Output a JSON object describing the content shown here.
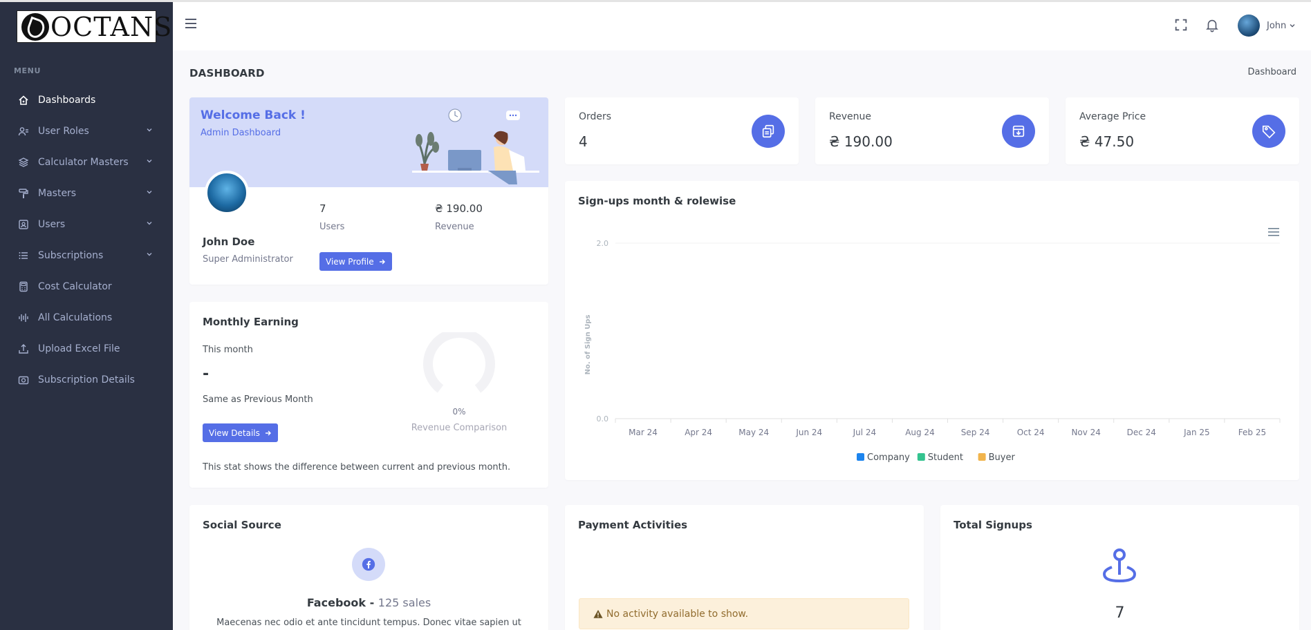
{
  "brand": {
    "logo_text": "OCTANS"
  },
  "sidebar": {
    "menu_title": "MENU",
    "items": [
      {
        "label": "Dashboards",
        "icon": "home-icon",
        "active": true,
        "has_children": false
      },
      {
        "label": "User Roles",
        "icon": "user-roles-icon",
        "active": false,
        "has_children": true
      },
      {
        "label": "Calculator Masters",
        "icon": "layers-icon",
        "active": false,
        "has_children": true
      },
      {
        "label": "Masters",
        "icon": "paint-roller-icon",
        "active": false,
        "has_children": true
      },
      {
        "label": "Users",
        "icon": "user-card-icon",
        "active": false,
        "has_children": true
      },
      {
        "label": "Subscriptions",
        "icon": "list-icon",
        "active": false,
        "has_children": true
      },
      {
        "label": "Cost Calculator",
        "icon": "calculator-icon",
        "active": false,
        "has_children": false
      },
      {
        "label": "All Calculations",
        "icon": "equalizer-icon",
        "active": false,
        "has_children": false
      },
      {
        "label": "Upload Excel File",
        "icon": "upload-icon",
        "active": false,
        "has_children": false
      },
      {
        "label": "Subscription Details",
        "icon": "camera-icon",
        "active": false,
        "has_children": false
      }
    ]
  },
  "topbar": {
    "user_name": "John"
  },
  "page": {
    "title": "DASHBOARD",
    "breadcrumb": "Dashboard"
  },
  "welcome": {
    "heading": "Welcome Back !",
    "subheading": "Admin Dashboard",
    "name": "John Doe",
    "role": "Super Administrator",
    "users_value": "7",
    "users_label": "Users",
    "revenue_value": "₴ 190.00",
    "revenue_label": "Revenue",
    "button": "View Profile"
  },
  "stats": [
    {
      "label": "Orders",
      "value": "4",
      "icon": "copy-icon"
    },
    {
      "label": "Revenue",
      "value": "₴ 190.00",
      "icon": "archive-in-icon"
    },
    {
      "label": "Average Price",
      "value": "₴ 47.50",
      "icon": "price-tag-icon"
    }
  ],
  "earning": {
    "title": "Monthly Earning",
    "this_month_label": "This month",
    "this_month_value": "-",
    "comparison_text": "Same as Previous Month",
    "button": "View Details",
    "gauge_percent": "0%",
    "gauge_label": "Revenue Comparison",
    "gauge_value": 0,
    "footnote": "This stat shows the difference between current and previous month."
  },
  "signups": {
    "title": "Sign-ups month & rolewise"
  },
  "chart_data": {
    "type": "bar",
    "title": "",
    "xlabel": "",
    "ylabel": "No. of Sign Ups",
    "categories": [
      "Mar 24",
      "Apr 24",
      "May 24",
      "Jun 24",
      "Jul 24",
      "Aug 24",
      "Sep 24",
      "Oct 24",
      "Nov 24",
      "Dec 24",
      "Jan 25",
      "Feb 25"
    ],
    "yticks": [
      "0.0",
      "2.0"
    ],
    "ylim": [
      0,
      2
    ],
    "series": [
      {
        "name": "Company",
        "color": "#1c84ee",
        "values": [
          0,
          0,
          0,
          0,
          0,
          0,
          0,
          0,
          0,
          0,
          0,
          0
        ]
      },
      {
        "name": "Student",
        "color": "#34c38f",
        "values": [
          0,
          0,
          0,
          0,
          0,
          0,
          0,
          0,
          0,
          0,
          0,
          0
        ]
      },
      {
        "name": "Buyer",
        "color": "#f1b44c",
        "values": [
          0,
          0,
          0,
          0,
          0,
          0,
          0,
          0,
          0,
          0,
          0,
          0
        ]
      }
    ],
    "legend": "bottom-center",
    "grid": true
  },
  "social": {
    "title": "Social Source",
    "network": "Facebook - ",
    "sales": "125 sales",
    "text": "Maecenas nec odio et ante tincidunt tempus. Donec vitae sapien ut"
  },
  "payments": {
    "title": "Payment Activities",
    "empty_text": "No activity available to show."
  },
  "total_signups": {
    "title": "Total Signups",
    "value": "7"
  },
  "colors": {
    "primary": "#556ee6",
    "sidebar": "#2a3042",
    "welcome_bg": "#d4dbf9"
  }
}
